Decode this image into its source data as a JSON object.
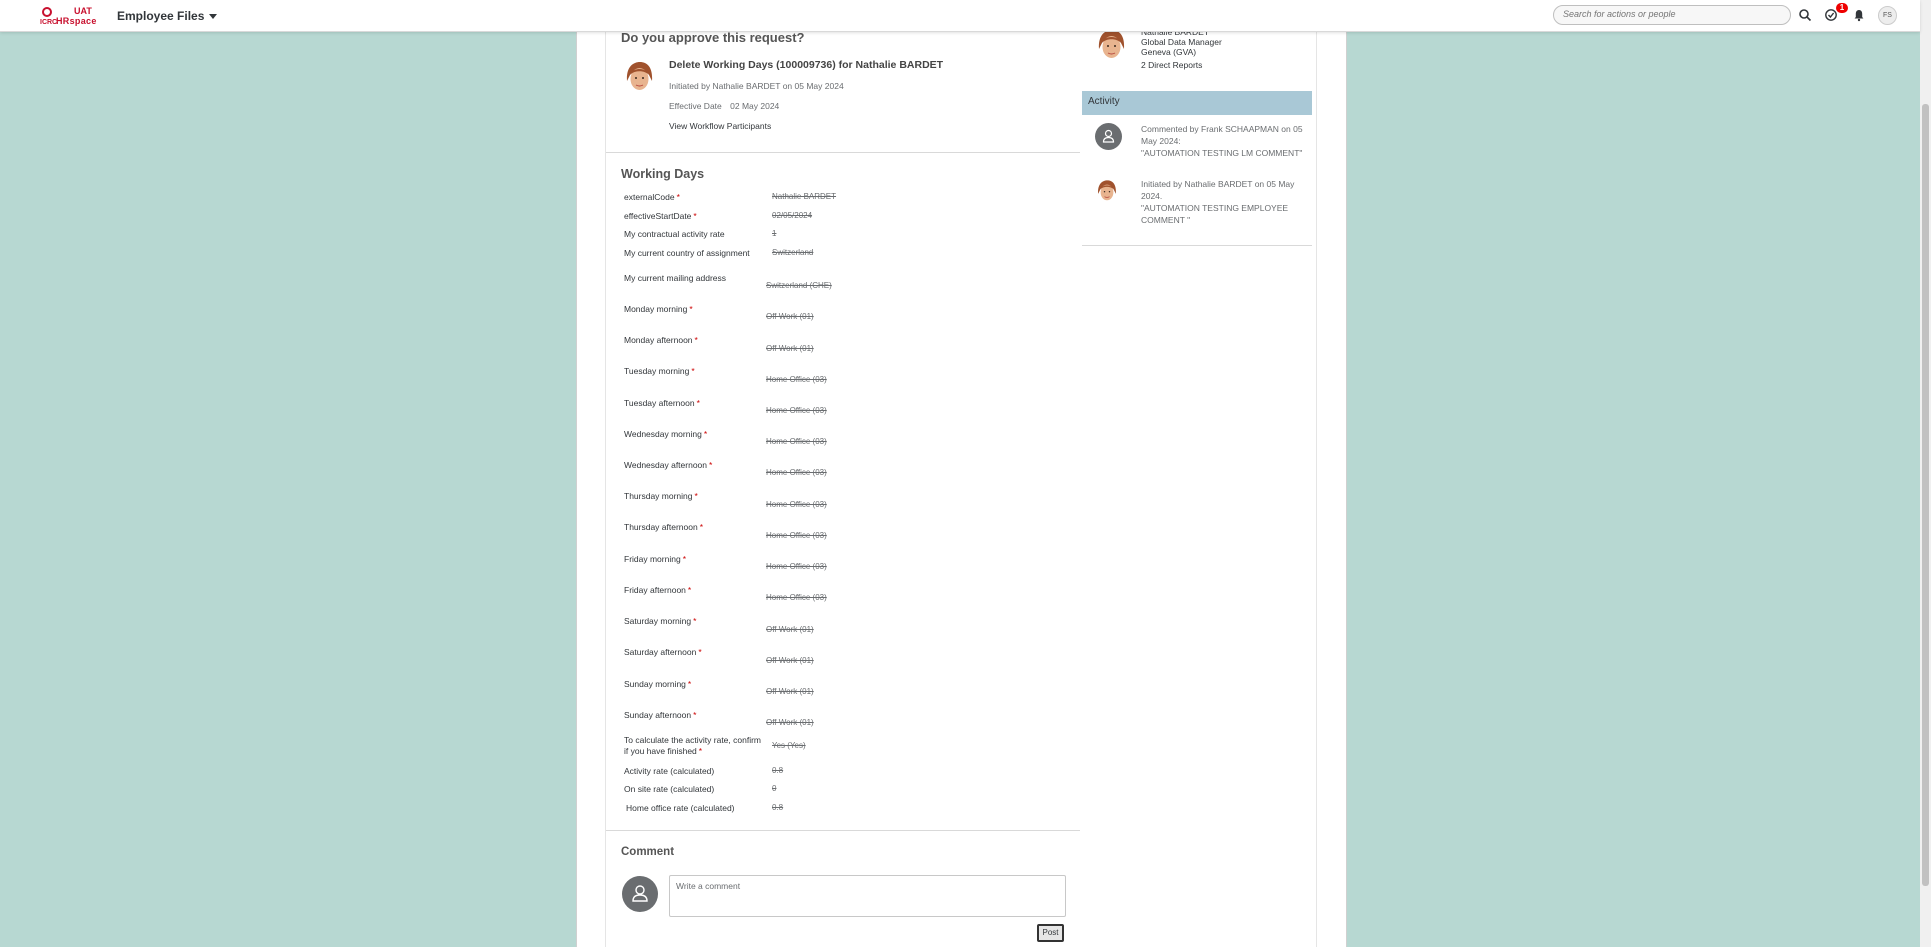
{
  "topbar": {
    "logo_org": "ICRC",
    "logo_env": "UAT",
    "logo_app": "HRspace",
    "module_label": "Employee Files",
    "search_placeholder": "Search for actions or people",
    "notification_count": "1",
    "user_initials": "FS",
    "icons": [
      "search-icon",
      "tasks-icon",
      "bell-icon"
    ]
  },
  "request": {
    "heading": "Do you approve this request?",
    "title": "Delete Working Days (100009736) for Nathalie BARDET",
    "initiated": "Initiated by Nathalie BARDET on 05 May 2024",
    "effective_label": "Effective Date",
    "effective_date": "02 May 2024",
    "participants_link": "View Workflow Participants"
  },
  "working_days": {
    "heading": "Working Days",
    "fields": [
      {
        "label": "externalCode",
        "required": "*",
        "value": "Nathalie BARDET"
      },
      {
        "label": "effectiveStartDate",
        "required": "*",
        "value": "02/05/2024"
      },
      {
        "label": "My contractual activity rate",
        "required": "",
        "value": "1"
      },
      {
        "label": "My current country of assignment",
        "required": "",
        "value": "Switzerland"
      },
      {
        "label": "My current mailing address",
        "required": "",
        "value": "Switzerland (CHE)"
      },
      {
        "label": "Monday morning",
        "required": "*",
        "value": "Off Work (01)"
      },
      {
        "label": "Monday afternoon",
        "required": "*",
        "value": "Off Work (01)"
      },
      {
        "label": "Tuesday morning",
        "required": "*",
        "value": "Home Office (03)"
      },
      {
        "label": "Tuesday afternoon",
        "required": "*",
        "value": "Home Office (03)"
      },
      {
        "label": "Wednesday morning",
        "required": "*",
        "value": "Home Office (03)"
      },
      {
        "label": "Wednesday afternoon",
        "required": "*",
        "value": "Home Office (03)"
      },
      {
        "label": "Thursday morning",
        "required": "*",
        "value": "Home Office (03)"
      },
      {
        "label": "Thursday afternoon",
        "required": "*",
        "value": "Home Office (03)"
      },
      {
        "label": "Friday morning",
        "required": "*",
        "value": "Home Office (03)"
      },
      {
        "label": "Friday afternoon",
        "required": "*",
        "value": "Home Office (03)"
      },
      {
        "label": "Saturday morning",
        "required": "*",
        "value": "Off Work (01)"
      },
      {
        "label": "Saturday afternoon",
        "required": "*",
        "value": "Off Work (01)"
      },
      {
        "label": "Sunday morning",
        "required": "*",
        "value": "Off Work (01)"
      },
      {
        "label": "Sunday afternoon",
        "required": "*",
        "value": "Off Work (01)"
      },
      {
        "label": "To calculate the activity rate, confirm",
        "label2": "if you have finished",
        "required": "*",
        "value": "Yes (Yes)"
      },
      {
        "label": "Activity rate (calculated)",
        "required": "",
        "value": "0.8"
      },
      {
        "label": "On site rate (calculated)",
        "required": "",
        "value": "0"
      },
      {
        "label": "Home office rate (calculated)",
        "required": "",
        "value": "0.8"
      }
    ]
  },
  "comment": {
    "heading": "Comment",
    "placeholder": "Write a comment",
    "post_label": "Post"
  },
  "sidebar": {
    "manager_name": "Nathalie BARDET",
    "manager_title": "Global Data Manager",
    "manager_location": "Geneva (GVA)",
    "direct_reports": "2 Direct Reports",
    "activity_heading": "Activity",
    "activity": [
      {
        "line1": "Commented by Frank SCHAAPMAN on 05",
        "line2": "May 2024:",
        "line3": "\"AUTOMATION TESTING LM COMMENT\""
      },
      {
        "line1": "Initiated by Nathalie BARDET on 05 May",
        "line2": "2024.",
        "line3": "\"AUTOMATION TESTING EMPLOYEE",
        "line4": "COMMENT \""
      }
    ]
  },
  "colors": {
    "background": "#b7d8d2",
    "brand_red": "#c8102e",
    "activity_header": "#a9c8d6",
    "required_star": "#cc0000"
  }
}
